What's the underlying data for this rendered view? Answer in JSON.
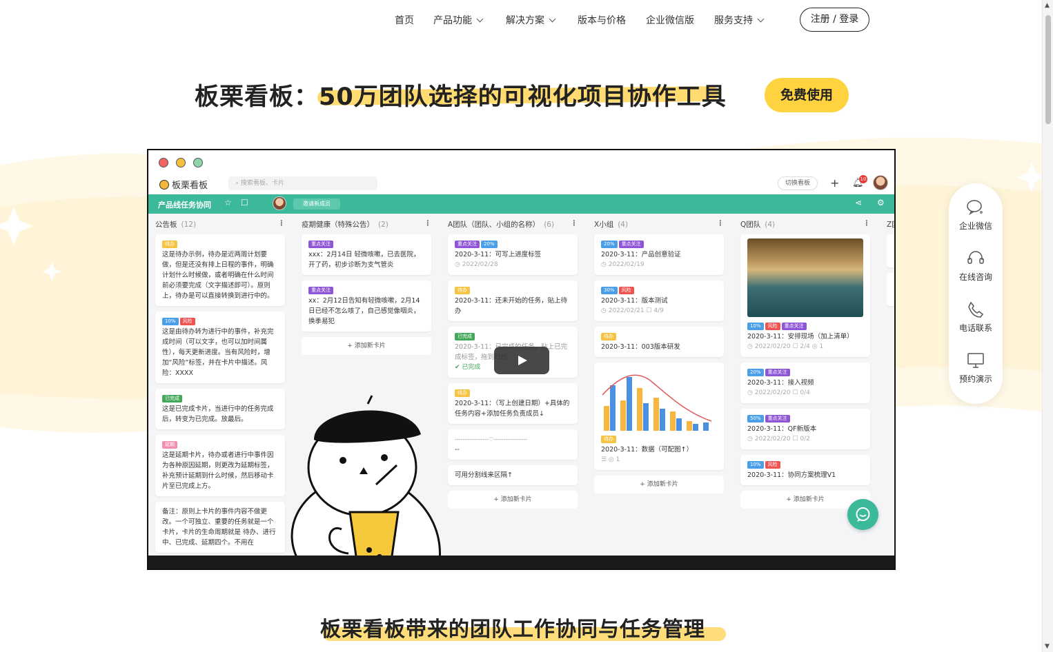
{
  "nav": {
    "home": "首页",
    "features": "产品功能",
    "solutions": "解决方案",
    "pricing": "版本与价格",
    "wecom": "企业微信版",
    "support": "服务支持",
    "login": "注册 / 登录"
  },
  "hero": {
    "title": "板栗看板：50万团队选择的可视化项目协作工具",
    "cta": "免费使用"
  },
  "app": {
    "brand": "板栗看板",
    "search_placeholder": "搜索看板、卡片",
    "switch_board": "切换看板",
    "notify_count": "10",
    "project_name": "产品线任务协同",
    "invite": "邀请新成员",
    "add_card": "+ 添加新卡片",
    "columns": [
      {
        "title": "公告板",
        "count": "(12)"
      },
      {
        "title": "疫期健康（特殊公告）",
        "count": "(2)"
      },
      {
        "title": "A团队（团队、小组的名称）",
        "count": "(6)"
      },
      {
        "title": "X小组",
        "count": "(4)"
      },
      {
        "title": "Q团队",
        "count": "(4)"
      },
      {
        "title": "Z团",
        "count": ""
      }
    ],
    "col1": [
      {
        "tag": "待办",
        "text": "这是待办示例，待办是近两周计划要做，但是还没有排上日程的事件，明确计划什么时候做，或者明确在什么时间前必须要完成（文字描述即可）。原则上，待办是可以直接转换到进行中的。"
      },
      {
        "tag1": "10%",
        "tag2": "风险",
        "text": "这是由待办转为进行中的事件，补充完成时间（可以文字，也可以加时间属性），每天更新进度。当有风险时，增加“风险”标签，并在卡片中描述。风险：XXXX"
      },
      {
        "tag": "已完成",
        "text": "这是已完成卡片，当进行中的任务完成后，转变为已完成。放最后。"
      },
      {
        "tag": "延期",
        "text": "这是延期卡片，待办或者进行中事件因为各种原因延期，则更改为延期标签，补充预计延期到什么时候，然后移动卡片至已完成上方。"
      },
      {
        "text": "备注：原则上卡片的事件内容不做更改。一个可独立、重要的任务就是一个卡片，卡片的生命周期就是 待办、进行中、已完成、延期四个。不用在"
      }
    ],
    "col2": [
      {
        "tag": "重点关注",
        "text": "xxx：2月14日 轻微咳嗽，已去医院，开了药，初步诊断为支气管炎"
      },
      {
        "tag": "重点关注",
        "text": "xx：2月12日告知有轻微咳嗽，2月14日已经不怎么咳了，自己感觉像咽炎，换季易犯"
      }
    ],
    "col3": [
      {
        "tag1": "重点关注",
        "tag2": "20%",
        "text": "2020-3-11：可写上进度标签",
        "date": "2022/02/28"
      },
      {
        "tag": "待办",
        "text": "2020-3-11：还未开始的任务，贴上待办"
      },
      {
        "tag": "已完成",
        "text": "2020-3-11：已完成的任务，贴上已完成标签，拖到归档",
        "status": "已完成"
      },
      {
        "tag": "待办",
        "text": "2020-3-11：（写上创建日期）+具体的任务内容+添加任务负责成员↓"
      },
      {
        "text": "-----------------♡-----------------",
        "text2": "--"
      },
      {
        "text": "可用分割线来区隔↑"
      }
    ],
    "col4": [
      {
        "tag1": "20%",
        "tag2": "重点关注",
        "text": "2020-3-11：产品创意验证",
        "date": "2022/02/19"
      },
      {
        "tag1": "30%",
        "tag2": "风险",
        "text": "2020-3-11：版本测试",
        "date": "2022/02/21",
        "sub": "4/9"
      },
      {
        "tag": "待办",
        "text": "2020-3-11：003版本研发"
      },
      {
        "tag": "待办",
        "text": "2020-3-11：数据（可配图↑）",
        "sub": "1"
      }
    ],
    "col5": [
      {
        "tag1": "10%",
        "tag2": "风险",
        "tag3": "重点关注",
        "text": "2020-3-11：安排现场（加上清单）",
        "date": "2022/02/20",
        "sub": "2/4",
        "sub2": "1"
      },
      {
        "tag1": "20%",
        "tag2": "重点关注",
        "text": "2020-3-11：接入视频",
        "date": "2022/02/20",
        "sub": "0/4"
      },
      {
        "tag1": "50%",
        "tag2": "重点关注",
        "text": "2020-3-11：QF新版本",
        "date": "2022/02/20",
        "sub": "0/2"
      },
      {
        "tag1": "10%",
        "tag2": "风险",
        "text": "2020-3-11：协同方案梳理V1"
      }
    ]
  },
  "side": {
    "wecom": "企业微信",
    "consult": "在线咨询",
    "phone": "电话联系",
    "demo": "预约演示"
  },
  "section": {
    "title": "板栗看板带来的团队工作协同与任务管理"
  },
  "colors": {
    "accent_yellow": "#ffd23f",
    "brand_green": "#3cb99a"
  }
}
